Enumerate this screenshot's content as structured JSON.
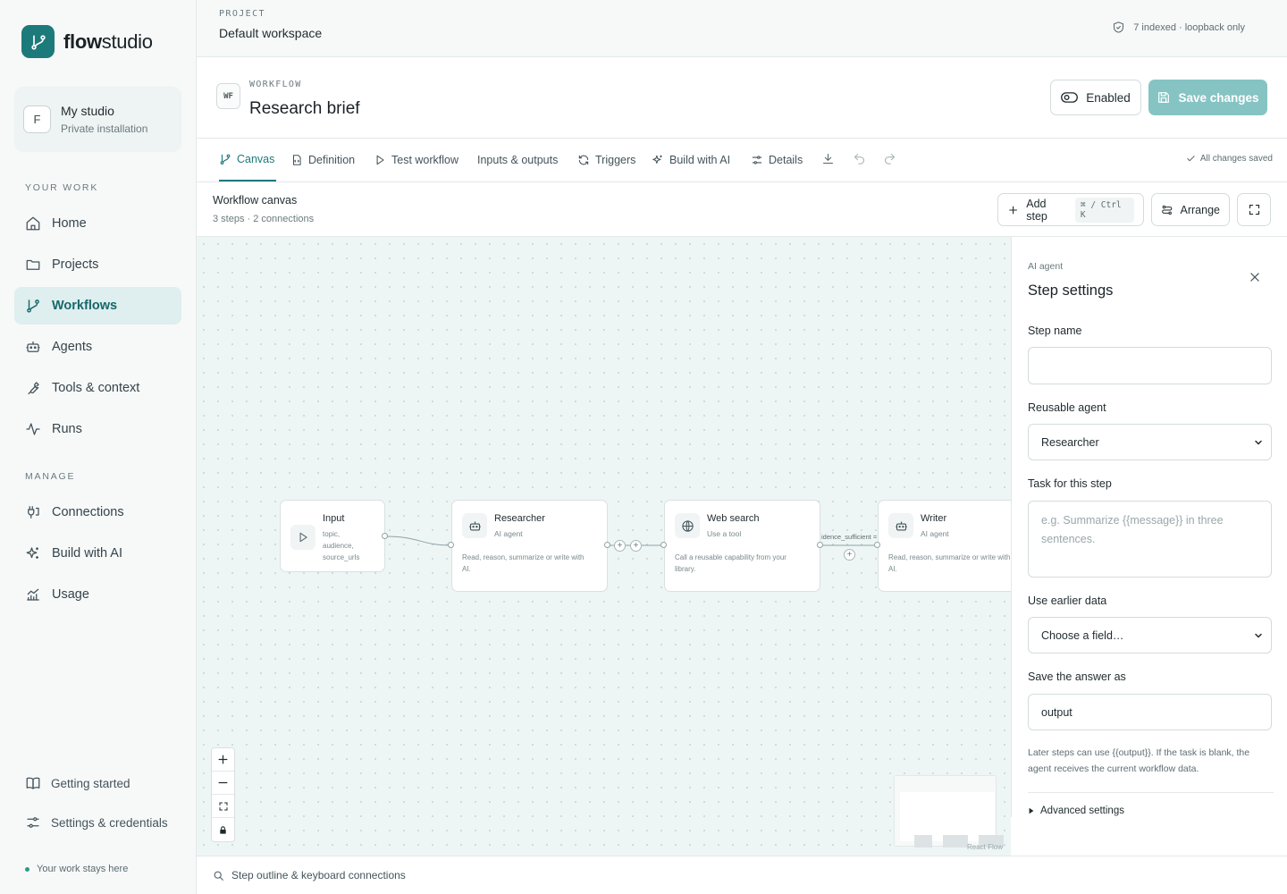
{
  "brand": {
    "name_bold": "flow",
    "name_rest": "studio",
    "logo_icon": "branch-icon",
    "accent": "#1d7a7a"
  },
  "studio": {
    "avatar": "F",
    "title": "My studio",
    "subtitle": "Private installation"
  },
  "nav": {
    "your_work_heading": "YOUR WORK",
    "your_work": [
      {
        "label": "Home",
        "icon": "home-icon"
      },
      {
        "label": "Projects",
        "icon": "folder-icon"
      },
      {
        "label": "Workflows",
        "icon": "branch-icon",
        "active": true
      },
      {
        "label": "Agents",
        "icon": "robot-icon"
      },
      {
        "label": "Tools & context",
        "icon": "wrench-icon"
      },
      {
        "label": "Runs",
        "icon": "activity-icon"
      }
    ],
    "manage_heading": "MANAGE",
    "manage": [
      {
        "label": "Connections",
        "icon": "plug-icon"
      },
      {
        "label": "Build with AI",
        "icon": "sparkles-icon"
      },
      {
        "label": "Usage",
        "icon": "chart-icon"
      }
    ]
  },
  "footer": {
    "getting_started": "Getting started",
    "settings": "Settings & credentials",
    "privacy": "Your work stays here"
  },
  "project": {
    "label": "PROJECT",
    "name": "Default workspace",
    "status": "7 indexed · loopback only"
  },
  "workflow": {
    "badge": "WF",
    "label": "WORKFLOW",
    "title": "Research brief",
    "enabled_label": "Enabled",
    "save_label": "Save changes"
  },
  "tabs": [
    {
      "label": "Canvas",
      "icon": "branch-icon",
      "active": true
    },
    {
      "label": "Definition",
      "icon": "document-code-icon"
    },
    {
      "label": "Test workflow",
      "icon": "play-icon"
    },
    {
      "label": "Inputs & outputs",
      "icon": ""
    },
    {
      "label": "Triggers",
      "icon": "refresh-icon"
    },
    {
      "label": "Build with AI",
      "icon": "sparkles-icon"
    },
    {
      "label": "Details",
      "icon": "sliders-icon"
    }
  ],
  "tab_actions": {
    "download_icon": "download-icon",
    "undo_icon": "undo-icon",
    "redo_icon": "redo-icon"
  },
  "saved_note": "All changes saved",
  "canvas": {
    "title": "Workflow canvas",
    "subtitle": "3 steps · 2 connections",
    "add_step": "Add step",
    "add_step_shortcut": "⌘ / Ctrl K",
    "arrange": "Arrange",
    "nodes": [
      {
        "title": "Input",
        "type": "",
        "fields": [
          "topic,",
          "audience,",
          "source_urls"
        ],
        "icon": "play-icon"
      },
      {
        "title": "Researcher",
        "type": "AI agent",
        "desc": [
          "Read, reason, summarize or write with",
          "AI."
        ],
        "icon": "robot-icon"
      },
      {
        "title": "Web search",
        "type": "Use a tool",
        "desc": [
          "Call a reusable capability from your",
          "library."
        ],
        "icon": "globe-icon"
      },
      {
        "title": "Writer",
        "type": "AI agent",
        "desc": [
          "Read, reason, summarize or write with",
          "AI."
        ],
        "icon": "robot-icon"
      }
    ],
    "edge_label": "idence_sufficient =",
    "attribution": "React Flow"
  },
  "panel": {
    "kicker": "AI agent",
    "title": "Step settings",
    "step_name_label": "Step name",
    "step_name_value": "",
    "agent_label": "Reusable agent",
    "agent_value": "Researcher",
    "task_label": "Task for this step",
    "task_placeholder": "e.g. Summarize {{message}} in three sentences.",
    "earlier_label": "Use earlier data",
    "earlier_value": "Choose a field…",
    "save_as_label": "Save the answer as",
    "save_as_value": "output",
    "help": "Later steps can use {{output}}. If the task is blank, the agent receives the current workflow data.",
    "advanced": "Advanced settings"
  },
  "bottom": {
    "outline": "Step outline & keyboard connections"
  }
}
